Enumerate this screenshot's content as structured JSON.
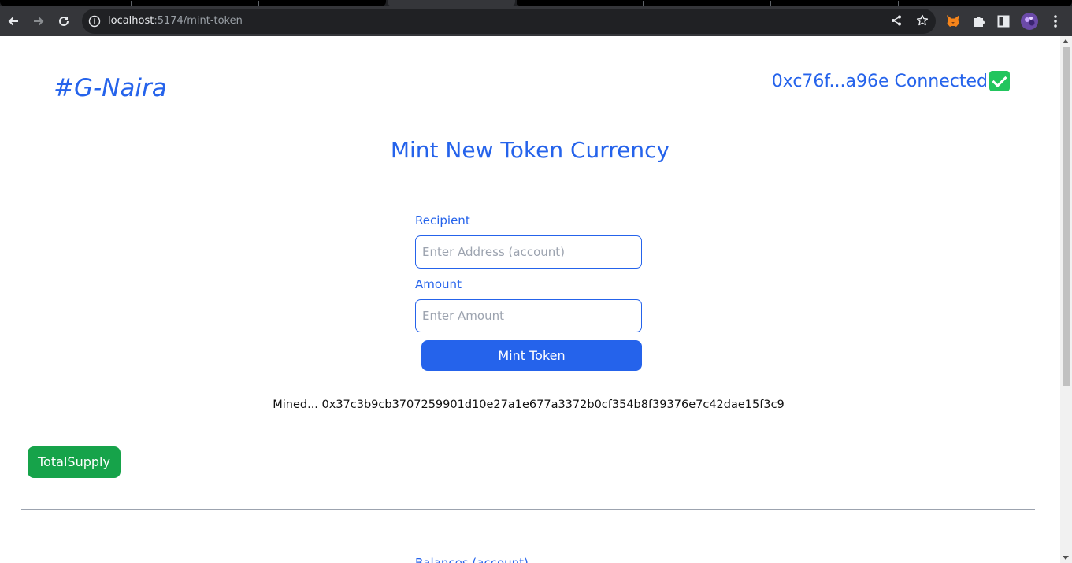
{
  "browser": {
    "url_host": "localhost",
    "url_path": ":5174/mint-token"
  },
  "app": {
    "brand": "#G-Naira",
    "wallet_status": "0xc76f...a96e Connected"
  },
  "main": {
    "title": "Mint New Token Currency",
    "recipient_label": "Recipient",
    "recipient_placeholder": "Enter Address (account)",
    "amount_label": "Amount",
    "amount_placeholder": "Enter Amount",
    "mint_button": "Mint Token",
    "mined_message": "Mined... 0x37c3b9cb3707259901d10e27a1e677a3372b0cf354b8f39376e7c42dae15f3c9",
    "total_supply_button": "TotalSupply",
    "balances_label": "Balances (account)"
  },
  "colors": {
    "accent": "#2563eb",
    "success": "#16a34a"
  }
}
